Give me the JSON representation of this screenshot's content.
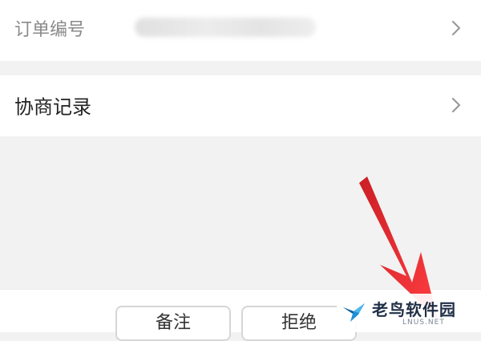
{
  "order_row": {
    "label": "订单编号",
    "icon": "chevron-right-icon"
  },
  "record_row": {
    "label": "协商记录",
    "icon": "chevron-right-icon"
  },
  "actions": {
    "note_label": "备注",
    "reject_label": "拒绝"
  },
  "annotation": {
    "arrow_color": "#e8262a",
    "icon": "red-arrow-annotation"
  },
  "watermark": {
    "name": "老鸟软件园",
    "domain": "LNUS.NET",
    "icon": "bird-logo-icon"
  },
  "colors": {
    "background": "#f2f2f2",
    "surface": "#ffffff",
    "secondary_text": "#8a8a8a",
    "button_border": "#d6d6d6"
  }
}
